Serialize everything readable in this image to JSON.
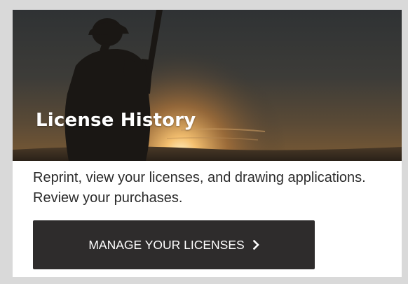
{
  "hero": {
    "title": "License History",
    "image": "silhouette-hunter-with-rifle-at-sunset"
  },
  "description": "Reprint, view your licenses, and drawing applications. Review your purchases.",
  "button": {
    "label": "MANAGE YOUR LICENSES",
    "icon": "chevron-right-icon"
  },
  "colors": {
    "button_bg": "#2e2c2c",
    "frame_border": "#d9d9d9",
    "text": "#2b2b2b"
  }
}
